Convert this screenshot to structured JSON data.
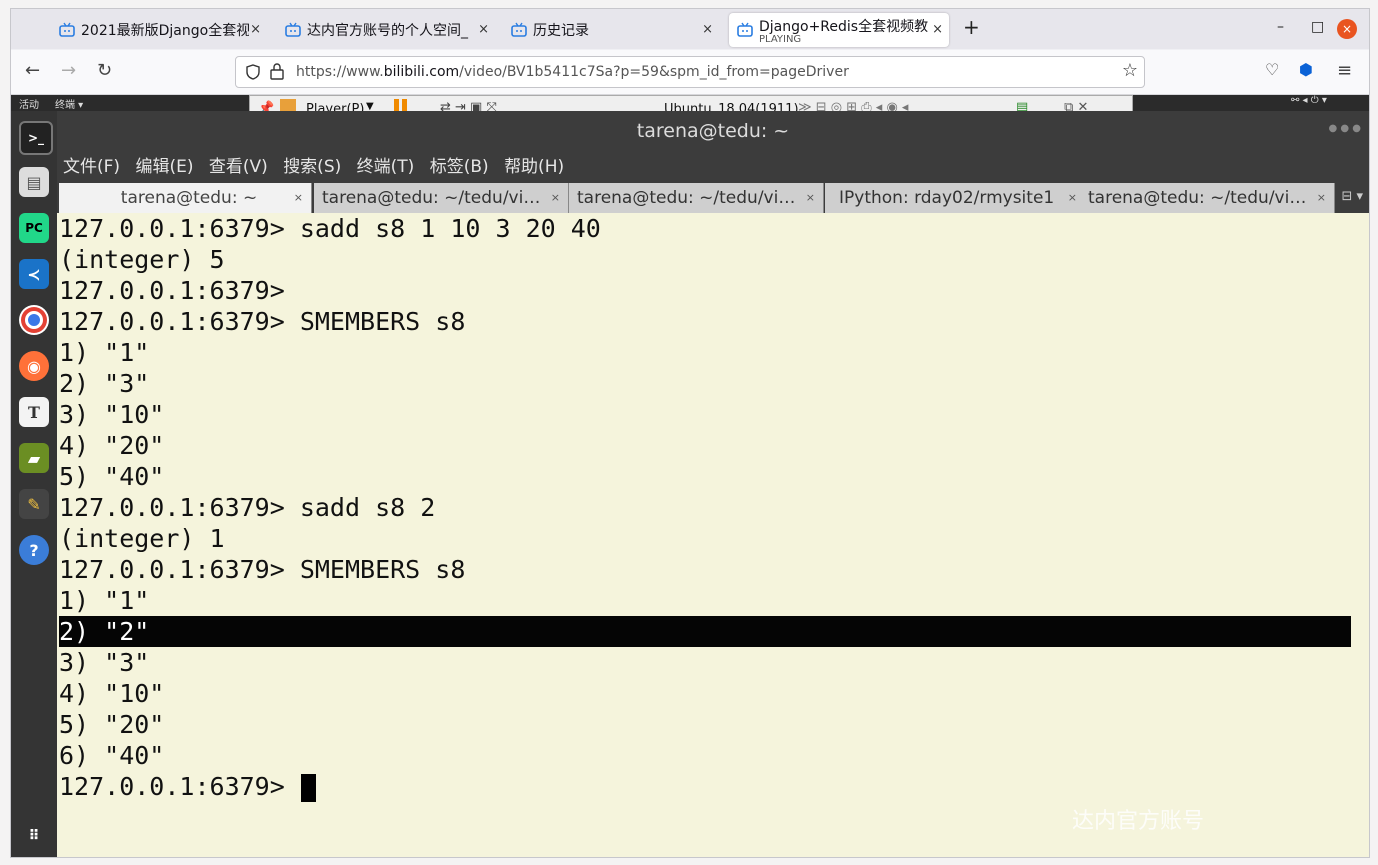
{
  "browser": {
    "tabs": [
      {
        "label": "2021最新版Django全套视",
        "close": "×"
      },
      {
        "label": "达内官方账号的个人空间_",
        "close": "×"
      },
      {
        "label": "历史记录",
        "close": "×"
      },
      {
        "label": "Django+Redis全套视频教",
        "sublabel": "PLAYING",
        "close": "×"
      }
    ],
    "new_tab": "+",
    "window_controls": {
      "minimize": "–",
      "maximize": "□",
      "close": "×"
    },
    "url_scheme": "https://www.",
    "url_domain": "bilibili.com",
    "url_path": "/video/BV1b5411c7Sa?p=59&spm_id_from=pageDriver"
  },
  "gnome": {
    "activities": "活动",
    "app_menu": "终端 ▾"
  },
  "vmware": {
    "player_menu": "Player(P)",
    "vm_name": "Ubuntu_18.04(1911)"
  },
  "terminal": {
    "window_title": "tarena@tedu: ~",
    "menu": [
      "文件(F)",
      "编辑(E)",
      "查看(V)",
      "搜索(S)",
      "终端(T)",
      "标签(B)",
      "帮助(H)"
    ],
    "tabs": [
      "tarena@tedu: ~",
      "tarena@tedu: ~/tedu/vi…",
      "tarena@tedu: ~/tedu/vi…",
      "IPython: rday02/rmysite1",
      "tarena@tedu: ~/tedu/vi…"
    ],
    "tab_close": "×",
    "lines": [
      "127.0.0.1:6379> sadd s8 1 10 3 20 40",
      "(integer) 5",
      "127.0.0.1:6379>",
      "127.0.0.1:6379> SMEMBERS s8",
      "1) \"1\"",
      "2) \"3\"",
      "3) \"10\"",
      "4) \"20\"",
      "5) \"40\"",
      "127.0.0.1:6379> sadd s8 2",
      "(integer) 1",
      "127.0.0.1:6379> SMEMBERS s8",
      "1) \"1\"",
      "2) \"2\"",
      "3) \"3\"",
      "4) \"10\"",
      "5) \"20\"",
      "6) \"40\"",
      "127.0.0.1:6379> "
    ],
    "highlighted_line": 13,
    "watermark": "达内官方账号"
  },
  "colors": {
    "terminal_bg": "#f5f4dc",
    "accent_close": "#e95420"
  }
}
